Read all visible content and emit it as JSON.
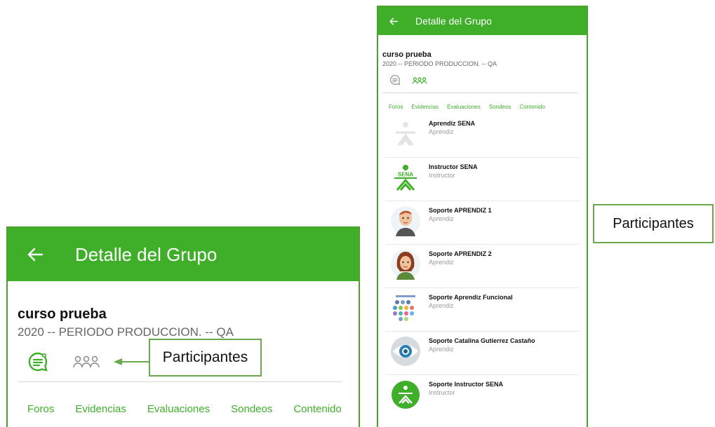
{
  "header": {
    "title": "Detalle del Grupo",
    "back_icon": "arrow-left-icon"
  },
  "course": {
    "name": "curso prueba",
    "period": "2020 -- PERIODO PRODUCCION. -- QA"
  },
  "toolbar": {
    "chat_icon": "chat-bubble-icon",
    "participants_icon": "people-group-icon"
  },
  "tabs": [
    "Foros",
    "Evidencias",
    "Evaluaciones",
    "Sondeos",
    "Contenido"
  ],
  "participants": [
    {
      "name": "Aprendiz SENA",
      "role": "Aprendiz",
      "avatar": "sena-faded-logo"
    },
    {
      "name": "Instructor SENA",
      "role": "Instructor",
      "avatar": "sena-logo"
    },
    {
      "name": "Soporte APRENDIZ  1",
      "role": "Aprendiz",
      "avatar": "male-avatar"
    },
    {
      "name": "Soporte APRENDIZ  2",
      "role": "Aprendiz",
      "avatar": "female-avatar"
    },
    {
      "name": "Soporte Aprendiz Funcional",
      "role": "Aprendiz",
      "avatar": "dots-avatar"
    },
    {
      "name": "Soporte Catalina Gutierrez Castaño",
      "role": "Aprendiz",
      "avatar": "eye-avatar"
    },
    {
      "name": "Soporte Instructor SENA",
      "role": "Instructor",
      "avatar": "sena-circle-avatar"
    }
  ],
  "callouts": {
    "big_label": "Participantes",
    "small_label": "Participantes"
  },
  "colors": {
    "primary": "#3fae29",
    "border": "#4aa22d",
    "callout_border": "#6aa84f"
  }
}
